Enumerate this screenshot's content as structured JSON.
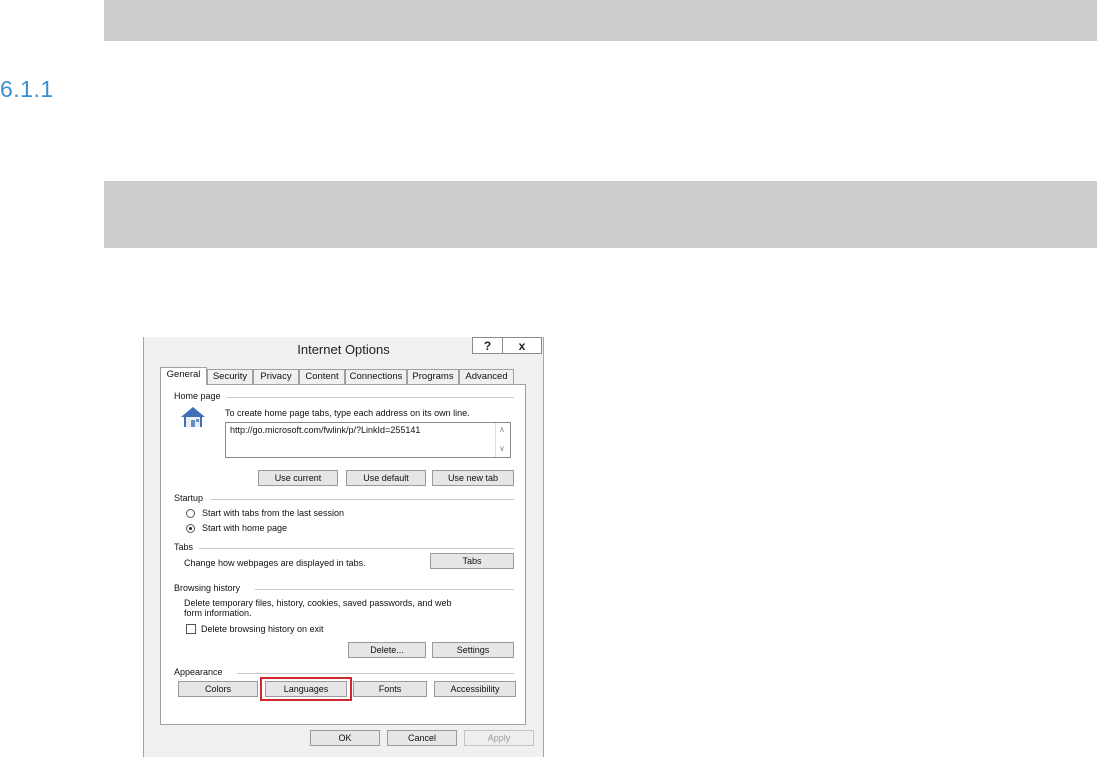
{
  "heading": "6.1.1",
  "dialog": {
    "title": "Internet Options",
    "help_label": "?",
    "close_label": "x",
    "tabs": [
      "General",
      "Security",
      "Privacy",
      "Content",
      "Connections",
      "Programs",
      "Advanced"
    ],
    "home_page": {
      "group_label": "Home page",
      "instruction": "To create home page tabs, type each address on its own line.",
      "address": "http://go.microsoft.com/fwlink/p/?LinkId=255141",
      "use_current": "Use current",
      "use_default": "Use default",
      "use_new_tab": "Use new tab"
    },
    "startup": {
      "group_label": "Startup",
      "option_last_session": "Start with tabs from the last session",
      "option_home_page": "Start with home page"
    },
    "tabs_group": {
      "group_label": "Tabs",
      "description": "Change how webpages are displayed in tabs.",
      "tabs_button": "Tabs"
    },
    "browsing_history": {
      "group_label": "Browsing history",
      "description_line1": "Delete temporary files, history, cookies, saved passwords, and web",
      "description_line2": "form information.",
      "delete_on_exit": "Delete browsing history on exit",
      "delete_button": "Delete...",
      "settings_button": "Settings"
    },
    "appearance": {
      "group_label": "Appearance",
      "colors": "Colors",
      "languages": "Languages",
      "fonts": "Fonts",
      "accessibility": "Accessibility"
    },
    "footer": {
      "ok": "OK",
      "cancel": "Cancel",
      "apply": "Apply"
    }
  },
  "colors": {
    "heading": "#3a8fcf",
    "highlight": "#d1272e",
    "bar": "#cccccc"
  },
  "icons": {
    "home": "home-icon"
  }
}
